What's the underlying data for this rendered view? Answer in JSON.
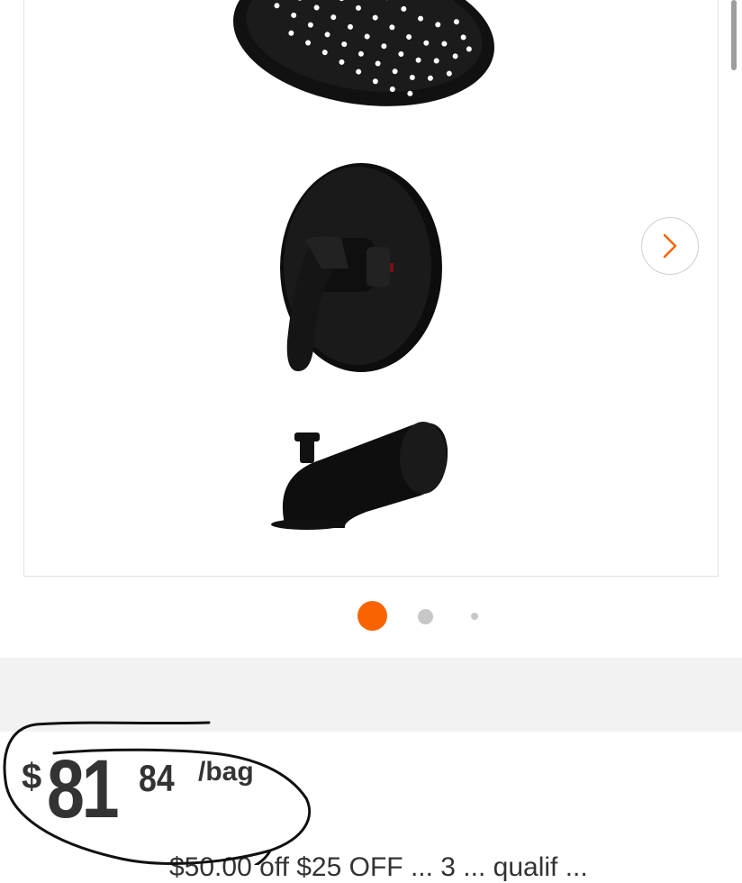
{
  "gallery": {
    "active_dot": 1,
    "dot_count": 3,
    "next_label": ">"
  },
  "price": {
    "currency": "$",
    "dollars": "81",
    "cents": "84",
    "unit": "/bag"
  },
  "promo": {
    "text": "$50.00 off $25 OFF ... 3 ... qualif ..."
  },
  "colors": {
    "accent": "#f96302",
    "text": "#333333",
    "gray_dot": "#c7c7c7"
  }
}
